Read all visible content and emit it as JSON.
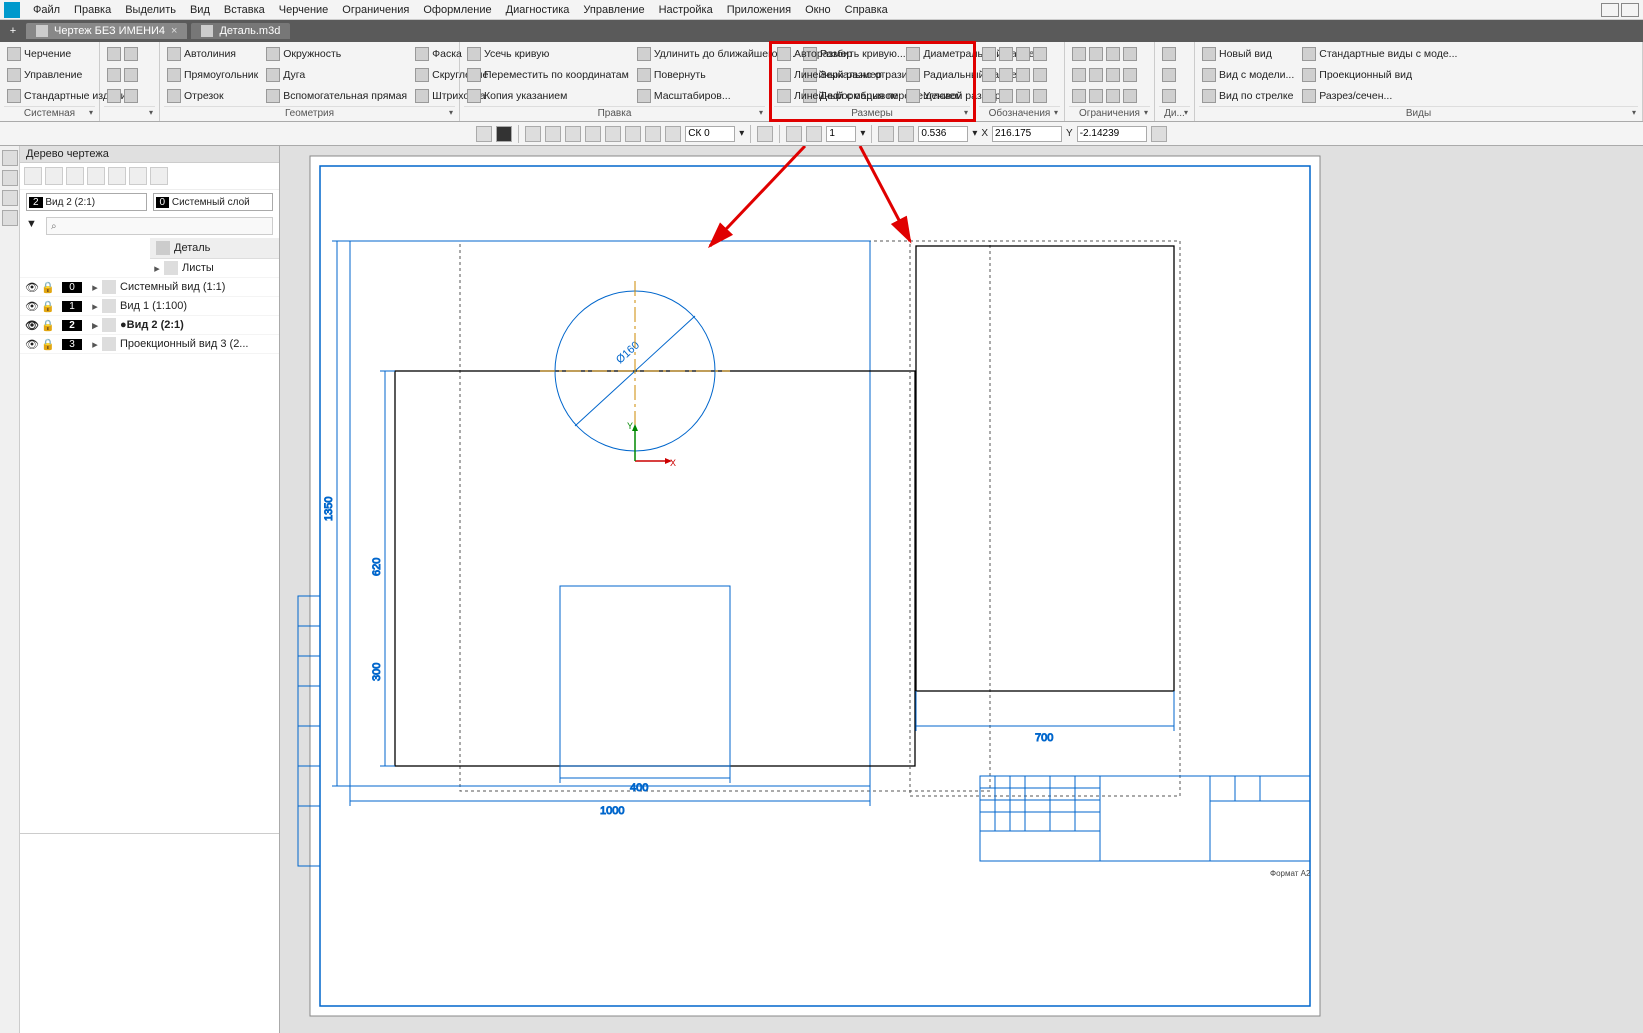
{
  "menu": {
    "items": [
      "Файл",
      "Правка",
      "Выделить",
      "Вид",
      "Вставка",
      "Черчение",
      "Ограничения",
      "Оформление",
      "Диагностика",
      "Управление",
      "Настройка",
      "Приложения",
      "Окно",
      "Справка"
    ]
  },
  "tabs": {
    "items": [
      {
        "label": "Чертеж БЕЗ ИМЕНИ4",
        "active": true
      },
      {
        "label": "Деталь.m3d",
        "active": false
      }
    ]
  },
  "ribbon": {
    "system": {
      "title": "Системная",
      "items": [
        "Черчение",
        "Управление",
        "Стандартные изделия"
      ]
    },
    "geometry": {
      "title": "Геометрия",
      "cols": [
        [
          "Автолиния",
          "Прямоугольник",
          "Отрезок"
        ],
        [
          "Окружность",
          "Дуга",
          "Вспомогательная прямая"
        ],
        [
          "Фаска",
          "Скругление",
          "Штриховка"
        ]
      ]
    },
    "edit": {
      "title": "Правка",
      "cols": [
        [
          "Усечь кривую",
          "Переместить по координатам",
          "Копия указанием"
        ],
        [
          "Удлинить до ближайшего о...",
          "Повернуть",
          "Масштабиров..."
        ],
        [
          "Разбить кривую...",
          "Зеркально отразить",
          "Деформация перемещением"
        ]
      ]
    },
    "dimensions": {
      "title": "Размеры",
      "cols": [
        [
          "Авторазмер",
          "Линейный размер",
          "Линейный с обрывом"
        ],
        [
          "Диаметральный размер",
          "Радиальный размер",
          "Угловой размер"
        ]
      ]
    },
    "designations": {
      "title": "Обозначения"
    },
    "constraints": {
      "title": "Ограничения"
    },
    "di": {
      "title": "Ди..."
    },
    "views": {
      "title": "Виды",
      "cols": [
        [
          "Новый вид",
          "Вид с модели...",
          "Вид по стрелке"
        ],
        [
          "Стандартные виды с моде...",
          "Проекционный вид",
          "Разрез/сечен..."
        ]
      ]
    }
  },
  "status": {
    "sk": "СК 0",
    "scale": "1",
    "zoom": "0.536",
    "x_label": "X",
    "x": "216.175",
    "y_label": "Y",
    "y": "-2.14239"
  },
  "side": {
    "title": "Дерево чертежа",
    "view_label": "Вид 2 (2:1)",
    "view_badge": "2",
    "layer_label": "Системный слой",
    "layer_badge": "0",
    "detail": "Деталь",
    "sheets": "Листы",
    "rows": [
      {
        "num": "0",
        "label": "Системный вид (1:1)"
      },
      {
        "num": "1",
        "label": "Вид 1 (1:100)"
      },
      {
        "num": "2",
        "label": "Вид 2 (2:1)",
        "current": true
      },
      {
        "num": "3",
        "label": "Проекционный вид 3 (2..."
      }
    ]
  },
  "drawing": {
    "dims": {
      "w": "1000",
      "h": "1350",
      "inner_h": "620",
      "bottom_h": "300",
      "bottom_w": "400",
      "diam": "Ø160",
      "right_w": "700"
    }
  }
}
